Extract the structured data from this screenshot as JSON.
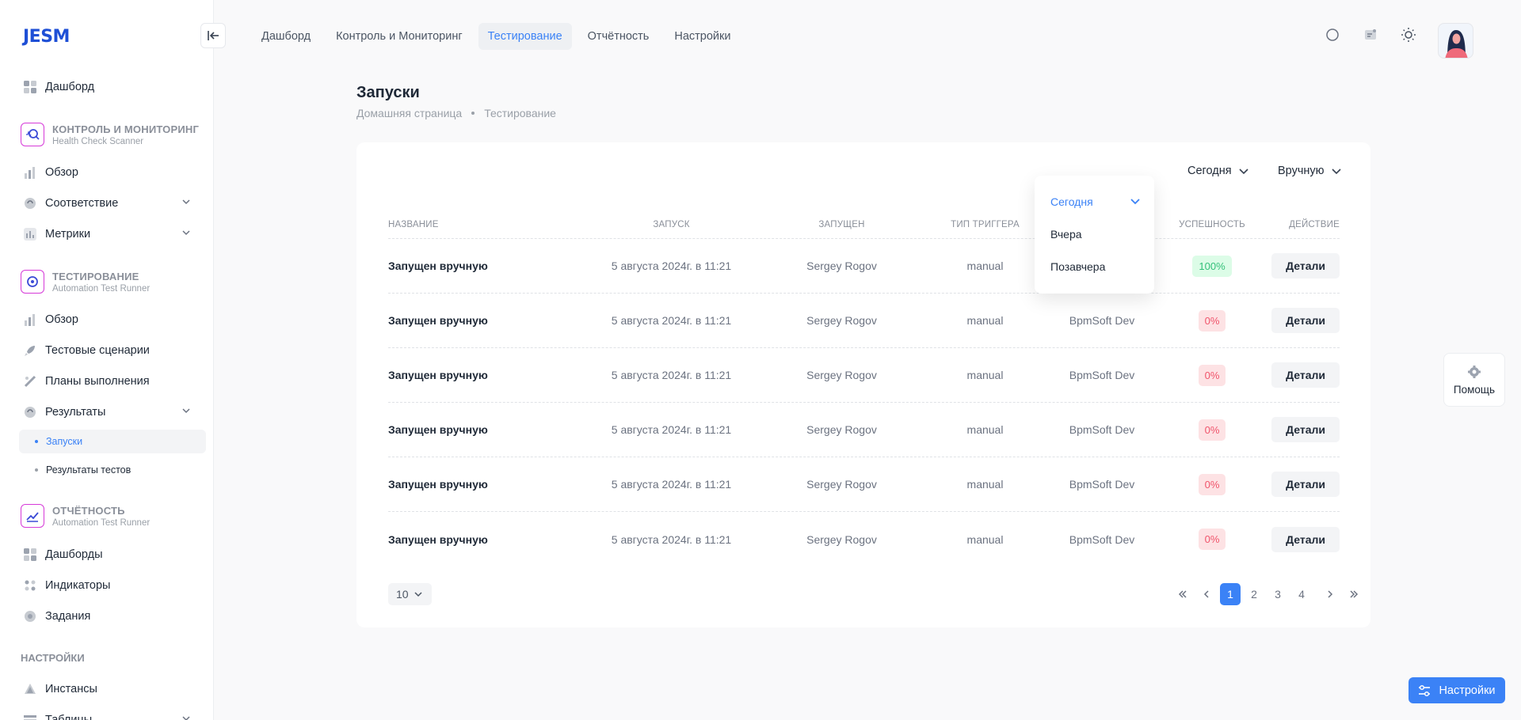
{
  "app": {
    "logo": "JESM"
  },
  "colors": {
    "accent": "#3b82f6",
    "brand": "#1e4fd6",
    "success": "#34c07a",
    "danger": "#f0546b"
  },
  "sidebar": {
    "dashboard": "Дашборд",
    "monitoring": {
      "title": "КОНТРОЛЬ И МОНИТОРИНГ",
      "subtitle": "Health Check Scanner",
      "items": [
        "Обзор",
        "Соответствие",
        "Метрики"
      ]
    },
    "testing": {
      "title": "ТЕСТИРОВАНИЕ",
      "subtitle": "Automation Test Runner",
      "items": [
        "Обзор",
        "Тестовые сценарии",
        "Планы выполнения",
        "Результаты"
      ],
      "sub_items": [
        "Запуски",
        "Результаты тестов"
      ]
    },
    "reporting": {
      "title": "ОТЧЁТНОСТЬ",
      "subtitle": "Automation Test Runner",
      "items": [
        "Дашборды",
        "Индикаторы",
        "Задания"
      ]
    },
    "settings": {
      "title": "НАСТРОЙКИ",
      "items": [
        "Инстансы",
        "Таблицы"
      ]
    }
  },
  "topnav": {
    "tabs": [
      "Дашборд",
      "Контроль и Мониторинг",
      "Тестирование",
      "Отчётность",
      "Настройки"
    ],
    "active": "Тестирование"
  },
  "page": {
    "title": "Запуски",
    "breadcrumb": [
      "Домашняя страница",
      "Тестирование"
    ]
  },
  "filters": {
    "period": "Сегодня",
    "trigger": "Вручную"
  },
  "dropdown": {
    "options": [
      "Сегодня",
      "Вчера",
      "Позавчера"
    ],
    "selected": "Сегодня"
  },
  "table": {
    "columns": [
      "НАЗВАНИЕ",
      "ЗАПУСК",
      "ЗАПУЩЕН",
      "ТИП ТРИГГЕРА",
      "",
      "УСПЕШНОСТЬ",
      "ДЕЙСТВИЕ"
    ],
    "rows": [
      {
        "name": "Запущен вручную",
        "launch": "5 августа 2024г. в 11:21",
        "by": "Sergey Rogov",
        "trigger": "manual",
        "env": "",
        "success": "100%",
        "action": "Детали",
        "status": "ok"
      },
      {
        "name": "Запущен вручную",
        "launch": "5 августа 2024г. в 11:21",
        "by": "Sergey Rogov",
        "trigger": "manual",
        "env": "BpmSoft Dev",
        "success": "0%",
        "action": "Детали",
        "status": "bad"
      },
      {
        "name": "Запущен вручную",
        "launch": "5 августа 2024г. в 11:21",
        "by": "Sergey Rogov",
        "trigger": "manual",
        "env": "BpmSoft Dev",
        "success": "0%",
        "action": "Детали",
        "status": "bad"
      },
      {
        "name": "Запущен вручную",
        "launch": "5 августа 2024г. в 11:21",
        "by": "Sergey Rogov",
        "trigger": "manual",
        "env": "BpmSoft Dev",
        "success": "0%",
        "action": "Детали",
        "status": "bad"
      },
      {
        "name": "Запущен вручную",
        "launch": "5 августа 2024г. в 11:21",
        "by": "Sergey Rogov",
        "trigger": "manual",
        "env": "BpmSoft Dev",
        "success": "0%",
        "action": "Детали",
        "status": "bad"
      },
      {
        "name": "Запущен вручную",
        "launch": "5 августа 2024г. в 11:21",
        "by": "Sergey Rogov",
        "trigger": "manual",
        "env": "BpmSoft Dev",
        "success": "0%",
        "action": "Детали",
        "status": "bad"
      }
    ]
  },
  "pagination": {
    "per_page": "10",
    "pages": [
      "1",
      "2",
      "3",
      "4"
    ],
    "current": "1"
  },
  "help": {
    "label": "Помощь"
  },
  "settings_button": {
    "label": "Настройки"
  }
}
